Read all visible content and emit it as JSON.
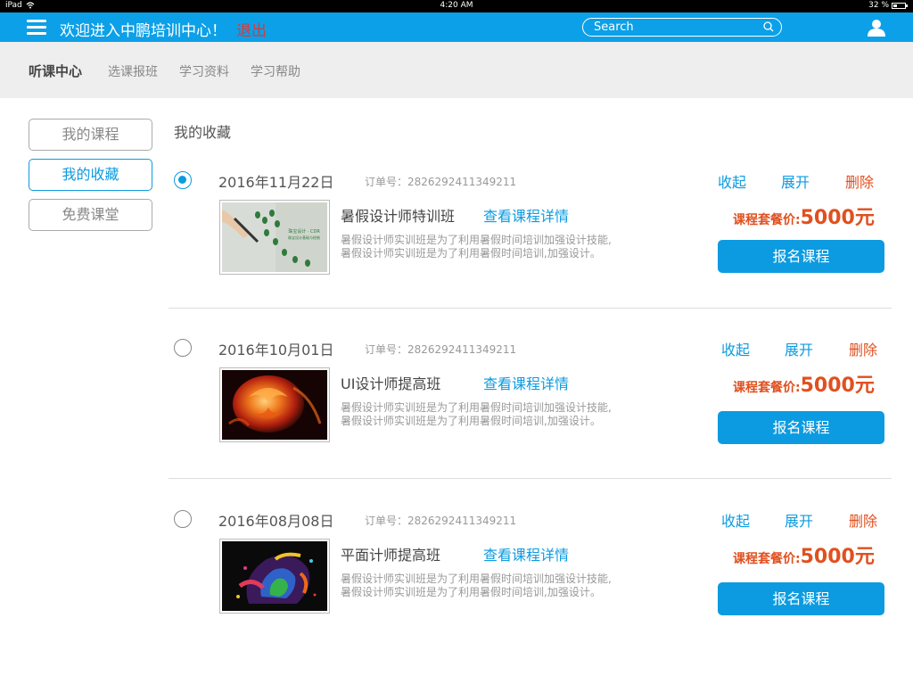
{
  "status_bar": {
    "device": "iPad",
    "time": "4:20 AM",
    "battery": "32 %",
    "battery_level": 0.32
  },
  "header": {
    "welcome": "欢迎进入中鹏培训中心！",
    "logout": "退出",
    "search_placeholder": "Search"
  },
  "nav": {
    "items": [
      {
        "label": "听课中心",
        "active": true
      },
      {
        "label": "选课报班",
        "active": false
      },
      {
        "label": "学习资料",
        "active": false
      },
      {
        "label": "学习帮助",
        "active": false
      }
    ]
  },
  "sidebar": {
    "items": [
      {
        "label": "我的课程",
        "active": false
      },
      {
        "label": "我的收藏",
        "active": true
      },
      {
        "label": "免费课堂",
        "active": false
      }
    ]
  },
  "section_title": "我的收藏",
  "courses": [
    {
      "selected": true,
      "date": "2016年11月22日",
      "order": "订单号：2826292411349211",
      "title": "暑假设计师特训班",
      "detail_link": "查看课程详情",
      "desc_line1": "暑假设计师实训班是为了利用暑假时间培训加强设计技能,",
      "desc_line2": "暑假设计师实训班是为了利用暑假时间培训,加强设计。",
      "collapse": "收起",
      "expand": "展开",
      "delete": "删除",
      "price_label": "课程套餐价:",
      "price_value": "5000元",
      "enroll": "报名课程",
      "thumb_icon": "pen-design-thumbnail",
      "thumb_text1": "珠宝设计 · CDR",
      "thumb_text2": "珠宝设计基础与绘制"
    },
    {
      "selected": false,
      "date": "2016年10月01日",
      "order": "订单号：2826292411349211",
      "title": "UI设计师提高班",
      "detail_link": "查看课程详情",
      "desc_line1": "暑假设计师实训班是为了利用暑假时间培训加强设计技能,",
      "desc_line2": "暑假设计师实训班是为了利用暑假时间培训,加强设计。",
      "collapse": "收起",
      "expand": "展开",
      "delete": "删除",
      "price_label": "课程套餐价:",
      "price_value": "5000元",
      "enroll": "报名课程",
      "thumb_icon": "fire-rose-thumbnail"
    },
    {
      "selected": false,
      "date": "2016年08月08日",
      "order": "订单号：2826292411349211",
      "title": "平面计师提高班",
      "detail_link": "查看课程详情",
      "desc_line1": "暑假设计师实训班是为了利用暑假时间培训加强设计技能,",
      "desc_line2": "暑假设计师实训班是为了利用暑假时间培训,加强设计。",
      "collapse": "收起",
      "expand": "展开",
      "delete": "删除",
      "price_label": "课程套餐价:",
      "price_value": "5000元",
      "enroll": "报名课程",
      "thumb_icon": "color-splash-thumbnail"
    }
  ],
  "colors": {
    "brand_blue": "#0ca0e8",
    "link_blue": "#0c9be0",
    "price_orange": "#e0501f",
    "logout_red": "#d63a3a"
  }
}
